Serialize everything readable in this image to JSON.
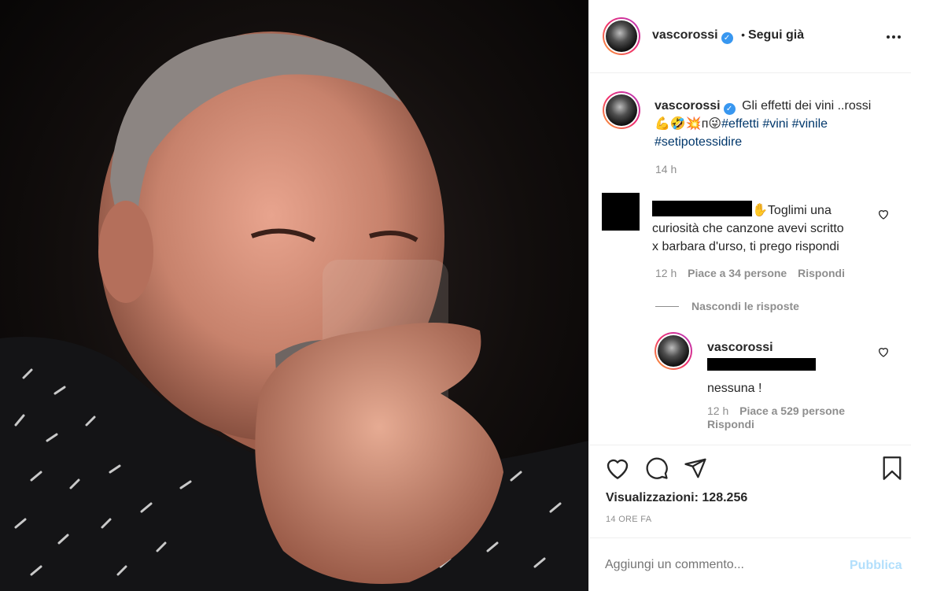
{
  "post": {
    "username": "vascorossi",
    "follow_status": "Segui già",
    "separator": "•",
    "more_icon": "more-horizontal-icon"
  },
  "caption": {
    "username": "vascorossi",
    "text_line1": "Gli effetti dei vini ..rossi",
    "emojis": "💪🤣💥ᴨ😜",
    "hashtags_line1": [
      "#effetti",
      "#vini",
      "#vinile"
    ],
    "hashtags_line2": [
      "#setipotessidire"
    ],
    "time": "14 h"
  },
  "comment": {
    "emoji": "✋",
    "text_start": "Toglimi una",
    "text_line2": "curiosità che canzone avevi scritto",
    "text_line3": "x barbara d'urso, ti prego rispondi",
    "time": "12 h",
    "likes": "Piace a 34 persone",
    "reply_label": "Rispondi",
    "hide_replies": "Nascondi le risposte"
  },
  "reply": {
    "username": "vascorossi",
    "text": "nessuna !",
    "time": "12 h",
    "likes": "Piace a 529 persone",
    "reply_label": "Rispondi"
  },
  "actions": {
    "views": "Visualizzazioni: 128.256",
    "timestamp": "14 ORE FA"
  },
  "add_comment": {
    "placeholder": "Aggiungi un commento...",
    "publish": "Pubblica"
  },
  "colors": {
    "link": "#00376b",
    "muted": "#8e8e8e",
    "publish": "#b2dffc",
    "verified": "#3897f0"
  }
}
